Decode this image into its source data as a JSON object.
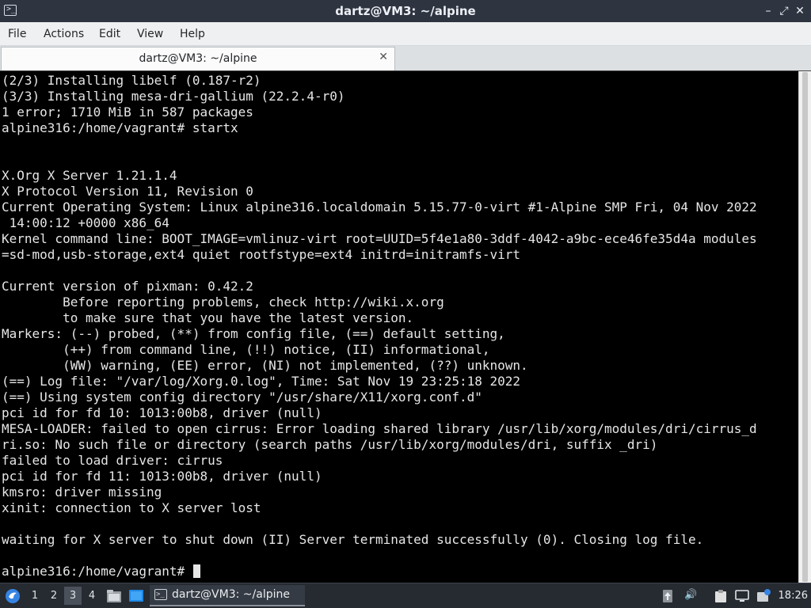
{
  "window": {
    "title": "dartz@VM3: ~/alpine",
    "icon": "terminal-icon"
  },
  "menu": {
    "items": [
      "File",
      "Actions",
      "Edit",
      "View",
      "Help"
    ]
  },
  "tabs": [
    {
      "label": "dartz@VM3: ~/alpine"
    }
  ],
  "terminal": {
    "lines": [
      "(2/3) Installing libelf (0.187-r2)",
      "(3/3) Installing mesa-dri-gallium (22.2.4-r0)",
      "1 error; 1710 MiB in 587 packages",
      "alpine316:/home/vagrant# startx",
      "",
      "",
      "X.Org X Server 1.21.1.4",
      "X Protocol Version 11, Revision 0",
      "Current Operating System: Linux alpine316.localdomain 5.15.77-0-virt #1-Alpine SMP Fri, 04 Nov 2022",
      " 14:00:12 +0000 x86_64",
      "Kernel command line: BOOT_IMAGE=vmlinuz-virt root=UUID=5f4e1a80-3ddf-4042-a9bc-ece46fe35d4a modules",
      "=sd-mod,usb-storage,ext4 quiet rootfstype=ext4 initrd=initramfs-virt",
      "",
      "Current version of pixman: 0.42.2",
      "        Before reporting problems, check http://wiki.x.org",
      "        to make sure that you have the latest version.",
      "Markers: (--) probed, (**) from config file, (==) default setting,",
      "        (++) from command line, (!!) notice, (II) informational,",
      "        (WW) warning, (EE) error, (NI) not implemented, (??) unknown.",
      "(==) Log file: \"/var/log/Xorg.0.log\", Time: Sat Nov 19 23:25:18 2022",
      "(==) Using system config directory \"/usr/share/X11/xorg.conf.d\"",
      "pci id for fd 10: 1013:00b8, driver (null)",
      "MESA-LOADER: failed to open cirrus: Error loading shared library /usr/lib/xorg/modules/dri/cirrus_d",
      "ri.so: No such file or directory (search paths /usr/lib/xorg/modules/dri, suffix _dri)",
      "failed to load driver: cirrus",
      "pci id for fd 11: 1013:00b8, driver (null)",
      "kmsro: driver missing",
      "xinit: connection to X server lost",
      "",
      "waiting for X server to shut down (II) Server terminated successfully (0). Closing log file.",
      "",
      "alpine316:/home/vagrant# "
    ]
  },
  "taskbar": {
    "workspaces": [
      "1",
      "2",
      "3",
      "4"
    ],
    "active_workspace": "3",
    "task_label": "dartz@VM3: ~/alpine",
    "clock": "18:26"
  },
  "colors": {
    "terminal_bg": "#000000",
    "terminal_fg": "#e6e6e6",
    "titlebar_bg": "#2e3440",
    "taskbar_bg": "#262a31"
  }
}
